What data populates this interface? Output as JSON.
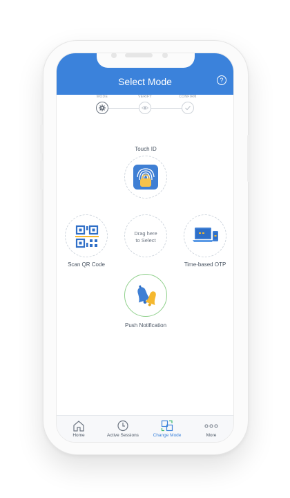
{
  "header": {
    "title": "Select Mode",
    "help_icon": "question-circle-icon",
    "color": "#3b82db"
  },
  "stepper": {
    "steps": [
      {
        "label": "MODE",
        "icon": "gear-icon",
        "active": true
      },
      {
        "label": "VERIFY",
        "icon": "eye-icon",
        "active": false
      },
      {
        "label": "CONFIRM",
        "icon": "checkmark-icon",
        "active": false
      }
    ]
  },
  "modes": {
    "touch_id": {
      "label": "Touch ID",
      "icon": "fingerprint-icon"
    },
    "scan_qr": {
      "label": "Scan QR Code",
      "icon": "qr-code-icon"
    },
    "drop_zone": {
      "line1": "Drag here",
      "line2": "to Select"
    },
    "totp": {
      "label": "Time-based OTP",
      "icon": "laptop-phone-icon"
    },
    "push": {
      "label": "Push Notification",
      "icon": "bell-icon"
    }
  },
  "tabbar": {
    "items": [
      {
        "label": "Home",
        "icon": "home-icon"
      },
      {
        "label": "Active Sessions",
        "icon": "clock-icon"
      },
      {
        "label": "Change Mode",
        "icon": "swap-mode-icon",
        "active": true
      },
      {
        "label": "More",
        "icon": "more-dots-icon"
      }
    ],
    "active_color": "#3b82db"
  }
}
